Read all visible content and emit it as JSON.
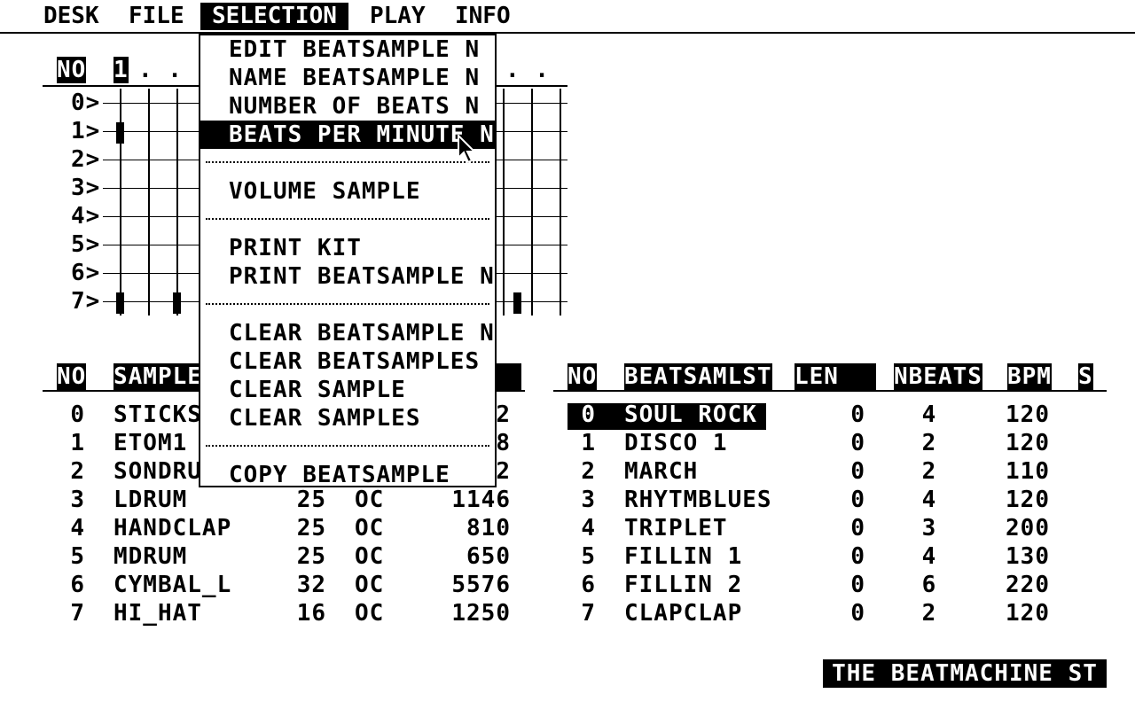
{
  "menubar": {
    "items": [
      "DESK",
      "FILE",
      "SELECTION",
      "PLAY",
      "INFO"
    ],
    "active": "SELECTION"
  },
  "pattern_grid": {
    "header_no": "NO",
    "header_step1": "1",
    "header_dots_left": ". .",
    "header_dots_right": ". .",
    "rows": [
      "0>",
      "1>",
      "2>",
      "3>",
      "4>",
      "5>",
      "6>",
      "7>"
    ]
  },
  "selection_menu": {
    "items": [
      {
        "label": "EDIT BEATSAMPLE N",
        "highlighted": false
      },
      {
        "label": "NAME BEATSAMPLE N",
        "highlighted": false
      },
      {
        "label": "NUMBER OF BEATS N",
        "highlighted": false
      },
      {
        "label": "BEATS PER MINUTE N",
        "highlighted": true
      },
      {
        "label": "VOLUME SAMPLE",
        "highlighted": false
      },
      {
        "label": "PRINT KIT",
        "highlighted": false
      },
      {
        "label": "PRINT BEATSAMPLE N",
        "highlighted": false
      },
      {
        "label": "CLEAR BEATSAMPLE N",
        "highlighted": false
      },
      {
        "label": "CLEAR BEATSAMPLES",
        "highlighted": false
      },
      {
        "label": "CLEAR SAMPLE",
        "highlighted": false
      },
      {
        "label": "CLEAR SAMPLES",
        "highlighted": false
      },
      {
        "label": "COPY BEATSAMPLE",
        "highlighted": false
      }
    ]
  },
  "samples_table": {
    "headers": {
      "no": "NO",
      "sample": "SAMPLE"
    },
    "rows": [
      {
        "no": "0",
        "name": "STICKS",
        "a": "",
        "b": "",
        "size": "2"
      },
      {
        "no": "1",
        "name": "ETOM1",
        "a": "",
        "b": "",
        "size": "8"
      },
      {
        "no": "2",
        "name": "SONDRU",
        "a": "",
        "b": "",
        "size": "2"
      },
      {
        "no": "3",
        "name": "LDRUM",
        "a": "25",
        "b": "OC",
        "size": "1146"
      },
      {
        "no": "4",
        "name": "HANDCLAP",
        "a": "25",
        "b": "OC",
        "size": "810"
      },
      {
        "no": "5",
        "name": "MDRUM",
        "a": "25",
        "b": "OC",
        "size": "650"
      },
      {
        "no": "6",
        "name": "CYMBAL_L",
        "a": "32",
        "b": "OC",
        "size": "5576"
      },
      {
        "no": "7",
        "name": "HI_HAT",
        "a": "16",
        "b": "OC",
        "size": "1250"
      }
    ]
  },
  "beatsamples_table": {
    "headers": {
      "no": "NO",
      "name": "BEATSAMLST",
      "len": "LEN",
      "nbeats": "NBEATS",
      "bpm": "BPM",
      "s": "S"
    },
    "rows": [
      {
        "no": "0",
        "name": "SOUL ROCK",
        "len": "0",
        "nbeats": "4",
        "bpm": "120",
        "selected": true
      },
      {
        "no": "1",
        "name": "DISCO 1",
        "len": "0",
        "nbeats": "2",
        "bpm": "120",
        "selected": false
      },
      {
        "no": "2",
        "name": "MARCH",
        "len": "0",
        "nbeats": "2",
        "bpm": "110",
        "selected": false
      },
      {
        "no": "3",
        "name": "RHYTMBLUES",
        "len": "0",
        "nbeats": "4",
        "bpm": "120",
        "selected": false
      },
      {
        "no": "4",
        "name": "TRIPLET",
        "len": "0",
        "nbeats": "3",
        "bpm": "200",
        "selected": false
      },
      {
        "no": "5",
        "name": "FILLIN 1",
        "len": "0",
        "nbeats": "4",
        "bpm": "130",
        "selected": false
      },
      {
        "no": "6",
        "name": "FILLIN 2",
        "len": "0",
        "nbeats": "6",
        "bpm": "220",
        "selected": false
      },
      {
        "no": "7",
        "name": "CLAPCLAP",
        "len": "0",
        "nbeats": "2",
        "bpm": "120",
        "selected": false
      }
    ]
  },
  "banner": {
    "text": "THE BEATMACHINE ST"
  },
  "colors": {
    "foreground": "#000000",
    "background": "#ffffff"
  }
}
